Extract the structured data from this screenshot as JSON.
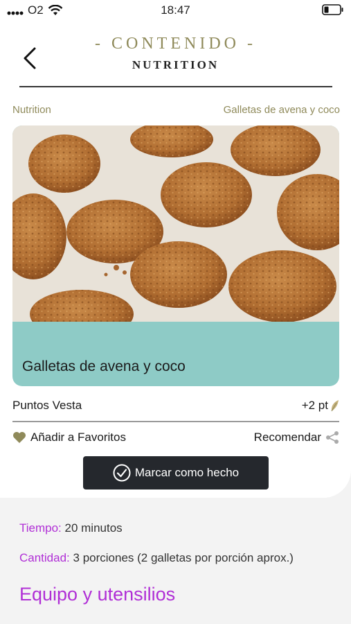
{
  "status": {
    "carrier": "O2",
    "time": "18:47"
  },
  "header": {
    "title": "- CONTENIDO -",
    "subtitle": "NUTRITION"
  },
  "breadcrumb": {
    "left": "Nutrition",
    "right": "Galletas de avena y coco"
  },
  "recipe": {
    "title": "Galletas de avena y coco"
  },
  "points": {
    "label": "Puntos Vesta",
    "value": "+2 pt"
  },
  "actions": {
    "favorite": "Añadir a Favoritos",
    "recommend": "Recomendar",
    "done": "Marcar como hecho"
  },
  "details": {
    "time_label": "Tiempo:",
    "time_value": "20 minutos",
    "qty_label": "Cantidad:",
    "qty_value": "3 porciones (2 galletas por porción aprox.)"
  },
  "section": {
    "title": "Equipo y utensilios"
  },
  "colors": {
    "accent_gold": "#8f8a5a",
    "teal": "#8ecbc6",
    "purple": "#b02fd6",
    "dark_button": "#25282d"
  }
}
